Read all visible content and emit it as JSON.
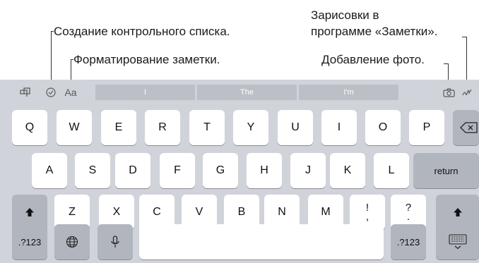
{
  "callouts": {
    "checklist": "Создание контрольного списка.",
    "format": "Форматирование заметки.",
    "sketch_line1": "Зарисовки в",
    "sketch_line2": "программе «Заметки».",
    "photo": "Добавление фото."
  },
  "toolbar": {
    "table_icon": "table-icon",
    "checklist_icon": "checklist-icon",
    "format_label": "Aa",
    "camera_icon": "camera-icon",
    "sketch_icon": "sketch-icon"
  },
  "suggestions": [
    "I",
    "The",
    "I'm"
  ],
  "keys": {
    "row1": [
      "Q",
      "W",
      "E",
      "R",
      "T",
      "Y",
      "U",
      "I",
      "O",
      "P"
    ],
    "row2": [
      "A",
      "S",
      "D",
      "F",
      "G",
      "H",
      "J",
      "K",
      "L"
    ],
    "return": "return",
    "row3": [
      "Z",
      "X",
      "C",
      "V",
      "B",
      "N",
      "M"
    ],
    "excl_top": "!",
    "excl_bottom": ",",
    "quest_top": "?",
    "quest_bottom": ".",
    "numbers": ".?123",
    "numbers_right": ".?123"
  },
  "colors": {
    "keyboard_bg": "#d0d3d9",
    "key": "#ffffff",
    "key_dark": "#b1b5bd"
  }
}
